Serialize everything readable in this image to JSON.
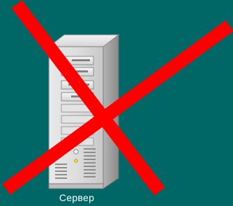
{
  "desktop": {
    "background_color": "#006666"
  },
  "server": {
    "label": "Сервер",
    "icon": "server-tower-icon",
    "status": "unavailable",
    "status_mark": "red-cross-icon",
    "colors": {
      "mark": "#ff0000",
      "label_text": "#ffffff"
    }
  }
}
